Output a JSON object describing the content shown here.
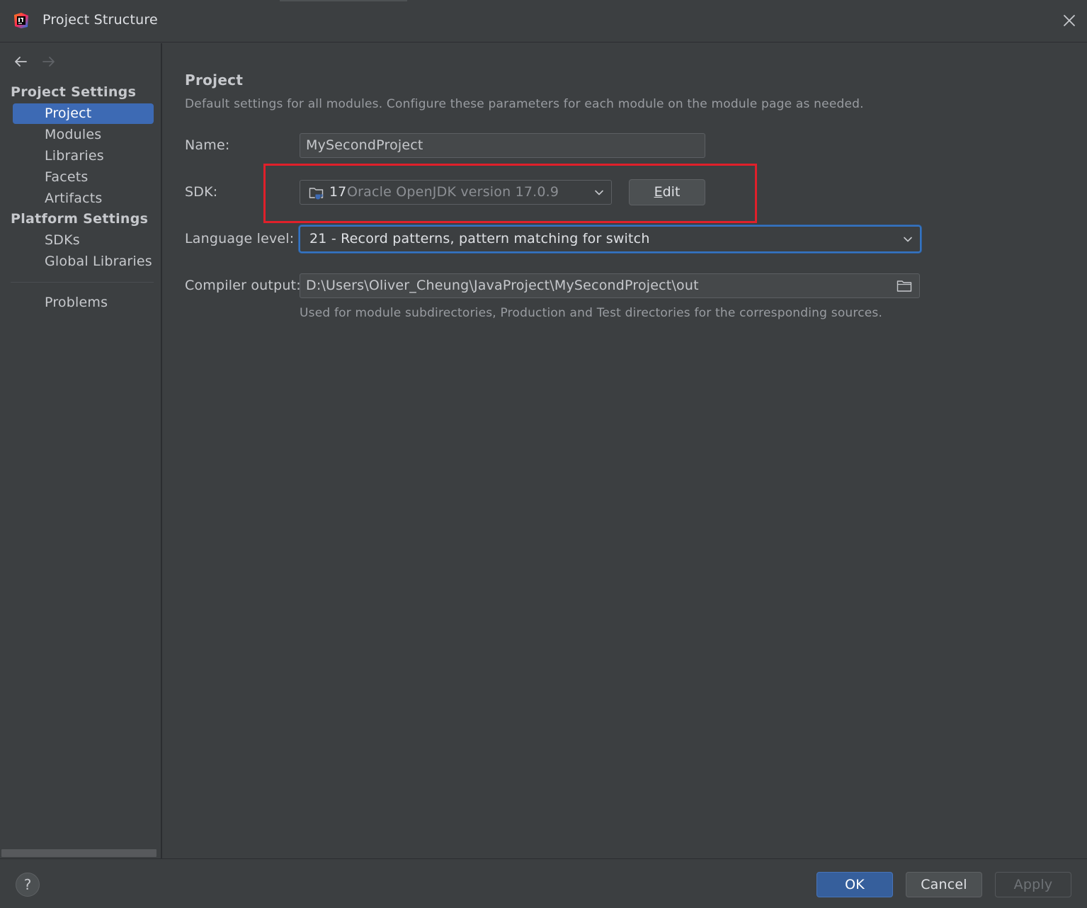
{
  "window": {
    "title": "Project Structure",
    "app_icon": "intellij-idea-icon",
    "close_icon": "close-icon"
  },
  "sidebar": {
    "back_icon": "arrow-left-icon",
    "forward_icon": "arrow-right-icon",
    "project_settings_title": "Project Settings",
    "project_items": [
      "Project",
      "Modules",
      "Libraries",
      "Facets",
      "Artifacts"
    ],
    "platform_settings_title": "Platform Settings",
    "platform_items": [
      "SDKs",
      "Global Libraries"
    ],
    "problems_label": "Problems",
    "selected_item": "Project"
  },
  "main": {
    "title": "Project",
    "description": "Default settings for all modules. Configure these parameters for each module on the module page as needed.",
    "name": {
      "label": "Name:",
      "value": "MySecondProject"
    },
    "sdk": {
      "label": "SDK:",
      "version": "17",
      "name": "Oracle OpenJDK version 17.0.9",
      "edit_label": "Edit",
      "icon": "jdk-folder-icon"
    },
    "language_level": {
      "label": "Language level:",
      "value": "21 - Record patterns, pattern matching for switch"
    },
    "compiler_output": {
      "label": "Compiler output:",
      "value": "D:\\Users\\Oliver_Cheung\\JavaProject\\MySecondProject\\out",
      "hint": "Used for module subdirectories, Production and Test directories for the corresponding sources.",
      "browse_icon": "folder-icon"
    }
  },
  "footer": {
    "help_label": "?",
    "ok_label": "OK",
    "cancel_label": "Cancel",
    "apply_label": "Apply"
  },
  "colors": {
    "background": "#3c3f41",
    "selection": "#3d6ab4",
    "focus_border": "#3574c2",
    "highlight_annotation": "#e0202a",
    "primary_button": "#365f9c"
  }
}
